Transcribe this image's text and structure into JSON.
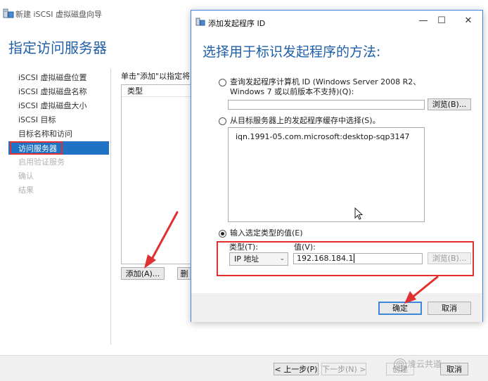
{
  "wizard": {
    "title": "新建 iSCSI 虚拟磁盘向导",
    "heading": "指定访问服务器",
    "nav": [
      {
        "label": "iSCSI 虚拟磁盘位置",
        "state": "normal"
      },
      {
        "label": "iSCSI 虚拟磁盘名称",
        "state": "normal"
      },
      {
        "label": "iSCSI 虚拟磁盘大小",
        "state": "normal"
      },
      {
        "label": "iSCSI 目标",
        "state": "normal"
      },
      {
        "label": "目标名称和访问",
        "state": "normal"
      },
      {
        "label": "访问服务器",
        "state": "active"
      },
      {
        "label": "启用验证服务",
        "state": "disabled"
      },
      {
        "label": "确认",
        "state": "disabled"
      },
      {
        "label": "结果",
        "state": "disabled"
      }
    ],
    "instruction": "单击\"添加\"以指定将访",
    "list_header": "类型",
    "add_button": "添加(A)...",
    "delete_button": "删",
    "footer": {
      "prev": "< 上一步(P)",
      "next": "下一步(N) >",
      "create": "创建",
      "cancel": "取消"
    }
  },
  "dialog": {
    "title": "添加发起程序 ID",
    "heading": "选择用于标识发起程序的方法:",
    "option_query_label": "查询发起程序计算机 ID (Windows Server 2008 R2、Windows 7 或以前版本不支持)(Q):",
    "option_query_value": "",
    "browse_button_1": "浏览(B)...",
    "option_cache_label": "从目标服务器上的发起程序缓存中选择(S)。",
    "cache_items": [
      "iqn.1991-05.com.microsoft:desktop-sqp3147"
    ],
    "option_manual_label": "输入选定类型的值(E)",
    "type_label": "类型(T):",
    "type_value": "IP 地址",
    "value_label": "值(V):",
    "value_value": "192.168.184.1",
    "browse_button_2": "浏览(B)...",
    "ok_button": "确定",
    "cancel_button": "取消",
    "selected_option": "manual"
  },
  "watermark": {
    "text": "凌云共道"
  },
  "colors": {
    "heading_blue": "#1f5fa8",
    "selection_blue": "#1f72c4",
    "annotation_red": "#e03030",
    "dialog_border": "#3d86d8"
  },
  "icons": {
    "wizard": "server-icon",
    "dialog": "server-icon",
    "minimize": "minimize-icon",
    "maximize": "maximize-icon",
    "close": "close-icon",
    "dropdown": "chevron-down-icon",
    "cursor": "mouse-cursor-icon",
    "annotation": "red-arrow-icon"
  }
}
